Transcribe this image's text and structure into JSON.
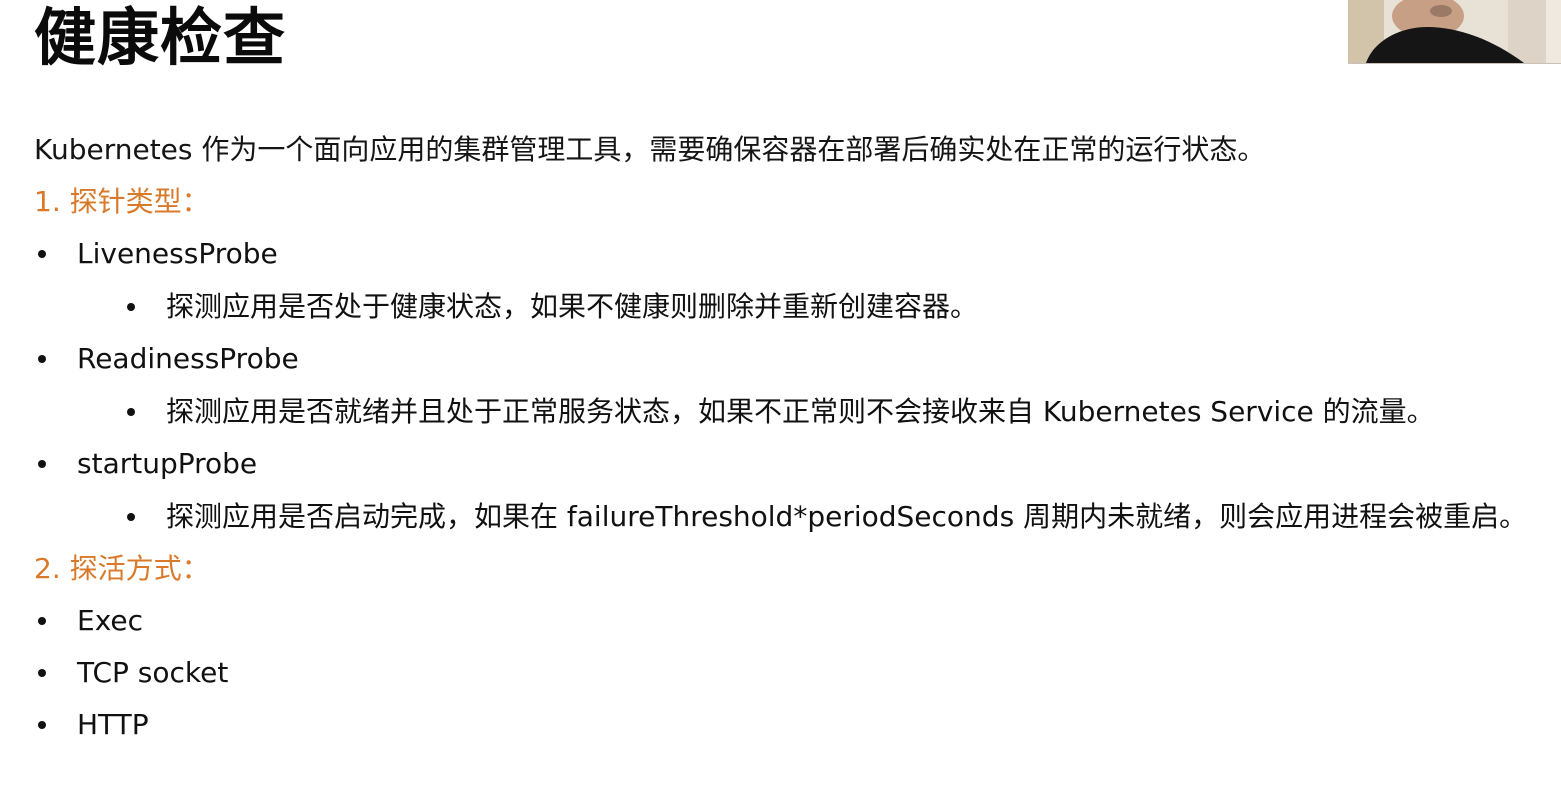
{
  "title": "健康检查",
  "intro": "Kubernetes 作为一个面向应用的集群管理工具，需要确保容器在部署后确实处在正常的运行状态。",
  "sections": [
    {
      "heading": "1. 探针类型：",
      "items": [
        {
          "label": "LivenessProbe",
          "detail": "探测应用是否处于健康状态，如果不健康则删除并重新创建容器。"
        },
        {
          "label": "ReadinessProbe",
          "detail": "探测应用是否就绪并且处于正常服务状态，如果不正常则不会接收来自 Kubernetes Service 的流量。"
        },
        {
          "label": "startupProbe",
          "detail": "探测应用是否启动完成，如果在 failureThreshold*periodSeconds 周期内未就绪，则会应用进程会被重启。"
        }
      ]
    },
    {
      "heading": "2. 探活方式：",
      "items": [
        {
          "label": "Exec"
        },
        {
          "label": "TCP socket"
        },
        {
          "label": "HTTP"
        }
      ]
    }
  ],
  "colors": {
    "section_heading": "#d97a2b",
    "text": "#111111",
    "background": "#ffffff"
  },
  "icons": {
    "bullet": "bullet-dot-icon"
  }
}
